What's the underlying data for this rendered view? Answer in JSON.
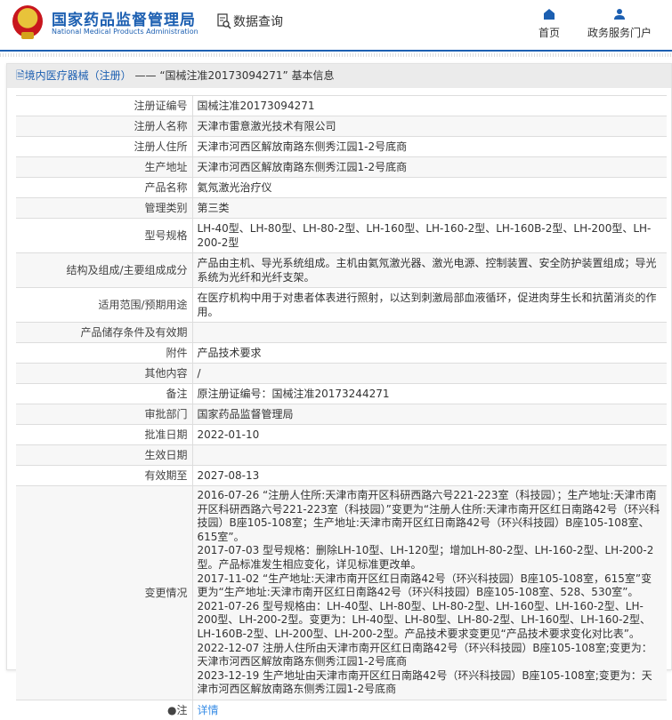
{
  "header": {
    "brand": "国家药品监督管理局",
    "brand_en": "National Medical Products Administration",
    "section": "数据查询",
    "nav": [
      {
        "label": "首页",
        "icon": "home-icon"
      },
      {
        "label": "政务服务门户",
        "icon": "user-icon"
      }
    ]
  },
  "panel": {
    "breadcrumb": "境内医疗器械（注册）",
    "separator": "——",
    "title": "“国械注准20173094271” 基本信息"
  },
  "rows": [
    {
      "label": "注册证编号",
      "value": "国械注准20173094271"
    },
    {
      "label": "注册人名称",
      "value": "天津市雷意激光技术有限公司"
    },
    {
      "label": "注册人住所",
      "value": "天津市河西区解放南路东侧秀江园1-2号底商"
    },
    {
      "label": "生产地址",
      "value": "天津市河西区解放南路东侧秀江园1-2号底商"
    },
    {
      "label": "产品名称",
      "value": "氦氖激光治疗仪"
    },
    {
      "label": "管理类别",
      "value": "第三类"
    },
    {
      "label": "型号规格",
      "value": "LH-40型、LH-80型、LH-80-2型、LH-160型、LH-160-2型、LH-160B-2型、LH-200型、LH-200-2型"
    },
    {
      "label": "结构及组成/主要组成成分",
      "value": "产品由主机、导光系统组成。主机由氦氖激光器、激光电源、控制装置、安全防护装置组成；导光系统为光纤和光纤支架。"
    },
    {
      "label": "适用范围/预期用途",
      "value": "在医疗机构中用于对患者体表进行照射，以达到刺激局部血液循环，促进肉芽生长和抗菌消炎的作用。"
    },
    {
      "label": "产品储存条件及有效期",
      "value": ""
    },
    {
      "label": "附件",
      "value": "产品技术要求"
    },
    {
      "label": "其他内容",
      "value": "/"
    },
    {
      "label": "备注",
      "value": "原注册证编号：国械注准20173244271"
    },
    {
      "label": "审批部门",
      "value": "国家药品监督管理局"
    },
    {
      "label": "批准日期",
      "value": "2022-01-10"
    },
    {
      "label": "生效日期",
      "value": ""
    },
    {
      "label": "有效期至",
      "value": "2027-08-13"
    }
  ],
  "changes": {
    "label": "变更情况",
    "items": [
      "2016-07-26 “注册人住所:天津市南开区科研西路六号221-223室（科技园）；生产地址:天津市南开区科研西路六号221-223室（科技园）”变更为“注册人住所:天津市南开区红日南路42号（环兴科技园）B座105-108室；生产地址:天津市南开区红日南路42号（环兴科技园）B座105-108室、615室”。",
      "2017-07-03 型号规格：删除LH-10型、LH-120型；增加LH-80-2型、LH-160-2型、LH-200-2型。产品标准发生相应变化，详见标准更改单。",
      "2017-11-02 “生产地址:天津市南开区红日南路42号（环兴科技园）B座105-108室，615室”变更为“生产地址:天津市南开区红日南路42号（环兴科技园）B座105-108室、528、530室”。",
      "2021-07-26 型号规格由：LH-40型、LH-80型、LH-80-2型、LH-160型、LH-160-2型、LH-200型、LH-200-2型。变更为：LH-40型、LH-80型、LH-80-2型、LH-160型、LH-160-2型、LH-160B-2型、LH-200型、LH-200-2型。产品技术要求变更见“产品技术要求变化对比表”。",
      "2022-12-07 注册人住所由天津市南开区红日南路42号（环兴科技园）B座105-108室;变更为：天津市河西区解放南路东侧秀江园1-2号底商",
      "2023-12-19 生产地址由天津市南开区红日南路42号（环兴科技园）B座105-108室;变更为：天津市河西区解放南路东侧秀江园1-2号底商"
    ]
  },
  "note": {
    "label": "注",
    "link": "详情"
  }
}
